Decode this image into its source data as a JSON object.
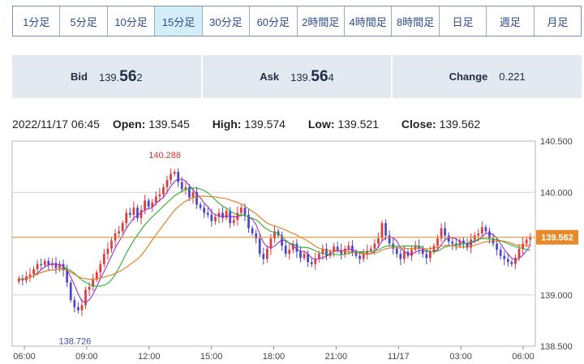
{
  "tabs": [
    {
      "label": "1分足"
    },
    {
      "label": "5分足"
    },
    {
      "label": "10分足"
    },
    {
      "label": "15分足"
    },
    {
      "label": "30分足"
    },
    {
      "label": "60分足"
    },
    {
      "label": "2時間足"
    },
    {
      "label": "4時間足"
    },
    {
      "label": "8時間足"
    },
    {
      "label": "日足"
    },
    {
      "label": "週足"
    },
    {
      "label": "月足"
    }
  ],
  "active_tab_index": 3,
  "quote": {
    "bid": {
      "label": "Bid",
      "prefix": "139.",
      "big": "56",
      "suffix": "2"
    },
    "ask": {
      "label": "Ask",
      "prefix": "139.",
      "big": "56",
      "suffix": "4"
    },
    "change": {
      "label": "Change",
      "value": "0.221"
    }
  },
  "ohlc": {
    "datetime": "2022/11/17 06:45",
    "open_label": "Open:",
    "open": "139.545",
    "high_label": "High:",
    "high": "139.574",
    "low_label": "Low:",
    "low": "139.521",
    "close_label": "Close:",
    "close": "139.562"
  },
  "chart_data": {
    "type": "candlestick",
    "ylim": [
      138.5,
      140.5
    ],
    "yticks": [
      "140.500",
      "140.000",
      "139.000",
      "138.500"
    ],
    "xticks": [
      "06:00",
      "09:00",
      "12:00",
      "15:00",
      "18:00",
      "21:00",
      "11/17",
      "03:00",
      "06:00"
    ],
    "current_price": "139.562",
    "high_annotation": "140.288",
    "low_annotation": "138.726",
    "grid": true,
    "up_color": "#e03a3a",
    "down_color": "#4a48c8",
    "ma_colors": [
      "#9b30c8",
      "#2db02d",
      "#e07a1a"
    ],
    "price_line_color": "#e88a2a",
    "close": [
      139.16,
      139.14,
      139.18,
      139.2,
      139.25,
      139.3,
      139.29,
      139.33,
      139.29,
      139.31,
      139.26,
      139.3,
      139.24,
      139.12,
      138.95,
      138.88,
      138.85,
      138.9,
      139.05,
      139.08,
      139.15,
      139.22,
      139.3,
      139.4,
      139.45,
      139.53,
      139.6,
      139.62,
      139.7,
      139.8,
      139.78,
      139.85,
      139.75,
      139.83,
      139.92,
      139.86,
      139.9,
      139.96,
      139.98,
      140.05,
      140.12,
      140.18,
      140.2,
      140.1,
      140.03,
      140.05,
      139.95,
      140.0,
      139.88,
      139.85,
      139.8,
      139.78,
      139.72,
      139.76,
      139.8,
      139.75,
      139.82,
      139.7,
      139.73,
      139.8,
      139.85,
      139.78,
      139.65,
      139.6,
      139.55,
      139.4,
      139.35,
      139.45,
      139.55,
      139.62,
      139.58,
      139.48,
      139.4,
      139.44,
      139.5,
      139.42,
      139.36,
      139.4,
      139.32,
      139.3,
      139.35,
      139.4,
      139.45,
      139.38,
      139.42,
      139.47,
      139.44,
      139.4,
      139.45,
      139.48,
      139.42,
      139.38,
      139.35,
      139.4,
      139.43,
      139.45,
      139.5,
      139.55,
      139.7,
      139.58,
      139.5,
      139.45,
      139.4,
      139.35,
      139.42,
      139.38,
      139.44,
      139.48,
      139.45,
      139.4,
      139.36,
      139.42,
      139.48,
      139.55,
      139.65,
      139.58,
      139.52,
      139.5,
      139.48,
      139.53,
      139.5,
      139.46,
      139.54,
      139.58,
      139.6,
      139.66,
      139.62,
      139.55,
      139.5,
      139.44,
      139.38,
      139.35,
      139.32,
      139.3,
      139.36,
      139.45,
      139.5,
      139.54,
      139.56
    ]
  }
}
